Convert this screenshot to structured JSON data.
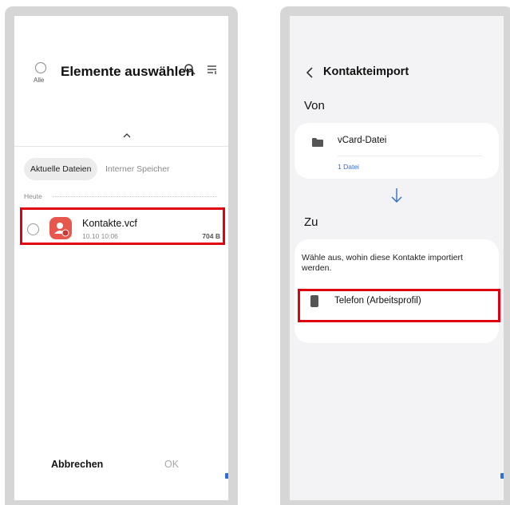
{
  "left_screen": {
    "select_all_label": "Alle",
    "title": "Elemente auswählen",
    "tabs": [
      {
        "label": "Aktuelle Dateien",
        "active": true
      },
      {
        "label": "Interner Speicher",
        "active": false
      }
    ],
    "section": "Heute",
    "file": {
      "name": "Kontakte.vcf",
      "date": "10.10 10:06",
      "size": "704 B"
    },
    "cancel_label": "Abbrechen",
    "ok_label": "OK"
  },
  "right_screen": {
    "title": "Kontakteimport",
    "from_label": "Von",
    "from_item": "vCard-Datei",
    "from_count": "1 Datei",
    "to_label": "Zu",
    "to_prompt": "Wähle aus, wohin diese Kontakte importiert werden.",
    "to_item": "Telefon (Arbeitsprofil)"
  },
  "colors": {
    "highlight": "#e0000f",
    "accent": "#2f6fd1",
    "file_icon": "#e8574e"
  },
  "icons": [
    "search-icon",
    "sort-icon",
    "chevron-up-icon",
    "contact-file-icon",
    "back-icon",
    "folder-icon",
    "arrow-down-icon",
    "phone-icon"
  ]
}
